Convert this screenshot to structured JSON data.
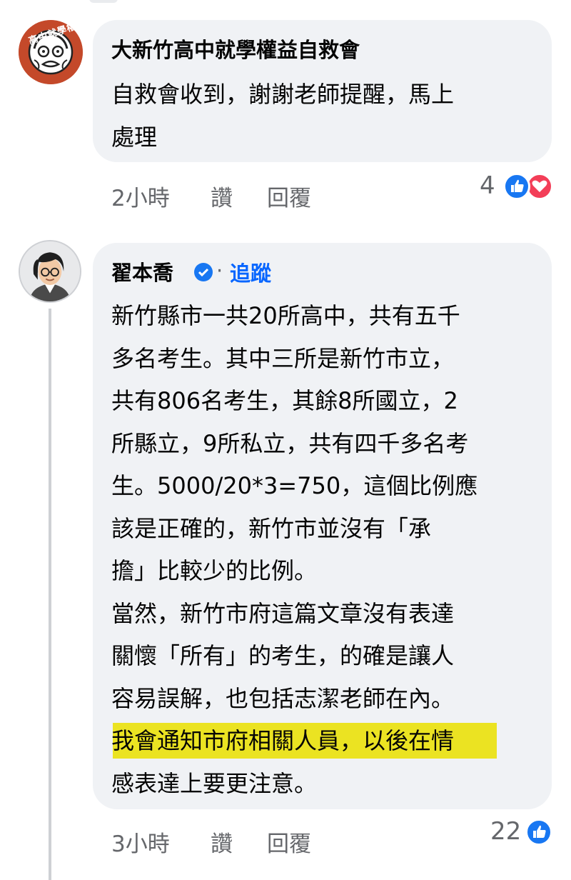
{
  "comment1": {
    "avatar_text": "高中就學權益",
    "author": "大新竹高中就學權益自救會",
    "lines": [
      "自救會收到，謝謝老師提醒，馬上",
      "處理"
    ],
    "time": "2小時",
    "like_label": "讚",
    "reply_label": "回覆",
    "reaction_count": "4",
    "reactions": [
      "like-icon",
      "love-icon"
    ]
  },
  "comment2": {
    "author": "翟本喬",
    "verified_icon": "verified-badge-icon",
    "dot": "·",
    "follow_label": "追蹤",
    "lines": [
      "新竹縣市一共20所高中，共有五千",
      "多名考生。其中三所是新竹市立，",
      "共有806名考生，其餘8所國立，2",
      "所縣立，9所私立，共有四千多名考",
      "生。5000/20*3=750，這個比例應",
      "該是正確的，新竹市並沒有「承",
      "擔」比較少的比例。",
      "當然，新竹市府這篇文章沒有表達",
      "關懷「所有」的考生，的確是讓人",
      "容易誤解，也包括志潔老師在內。",
      "我會通知市府相關人員，以後在情",
      "感表達上要更注意。"
    ],
    "highlight_color": "#ebe322",
    "time": "3小時",
    "like_label": "讚",
    "reply_label": "回覆",
    "reaction_count": "22",
    "reactions": [
      "like-icon"
    ]
  },
  "colors": {
    "bubble": "#f0f2f5",
    "meta": "#65676b",
    "accent": "#1877f2",
    "love": "#f33e58"
  }
}
